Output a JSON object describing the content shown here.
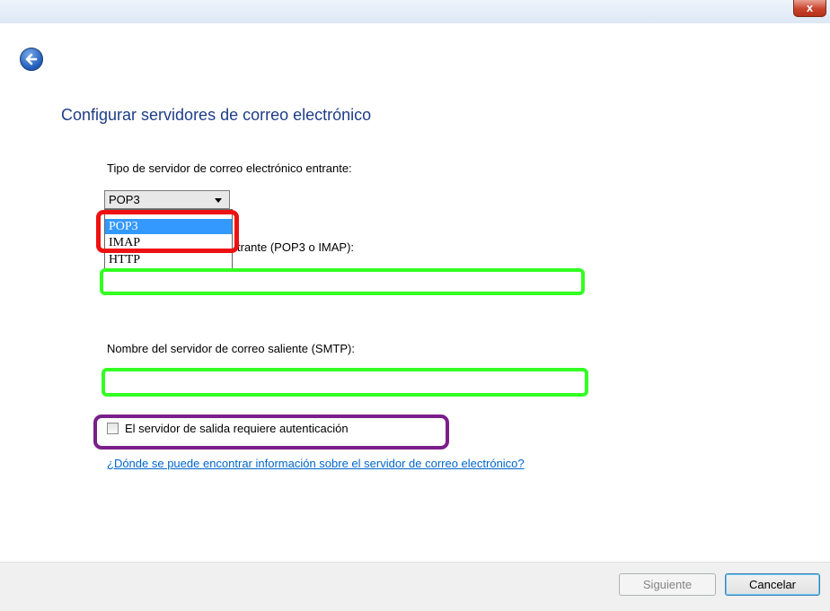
{
  "window": {
    "close_label": "x"
  },
  "heading": "Configurar servidores de correo electrónico",
  "incoming_type": {
    "label": "Tipo de servidor de correo electrónico entrante:",
    "selected": "POP3",
    "options": [
      "POP3",
      "IMAP",
      "HTTP"
    ]
  },
  "incoming_server": {
    "label_visible_part": "trante (POP3 o IMAP):",
    "value": ""
  },
  "outgoing_server": {
    "label": "Nombre del servidor de correo saliente (SMTP):",
    "value": ""
  },
  "auth_checkbox": {
    "label": "El servidor de salida requiere autenticación",
    "checked": false
  },
  "help_link": "¿Dónde se puede encontrar información sobre el servidor de correo electrónico?",
  "footer": {
    "next_label": "Siguiente",
    "cancel_label": "Cancelar"
  },
  "colors": {
    "heading": "#1e3d87",
    "link": "#0066cc",
    "highlight_red": "#ee1111",
    "highlight_green": "#33ff22",
    "highlight_purple": "#7a1f8a",
    "selection": "#3399ff"
  },
  "icons": {
    "back": "back-arrow-icon",
    "close": "close-icon"
  }
}
